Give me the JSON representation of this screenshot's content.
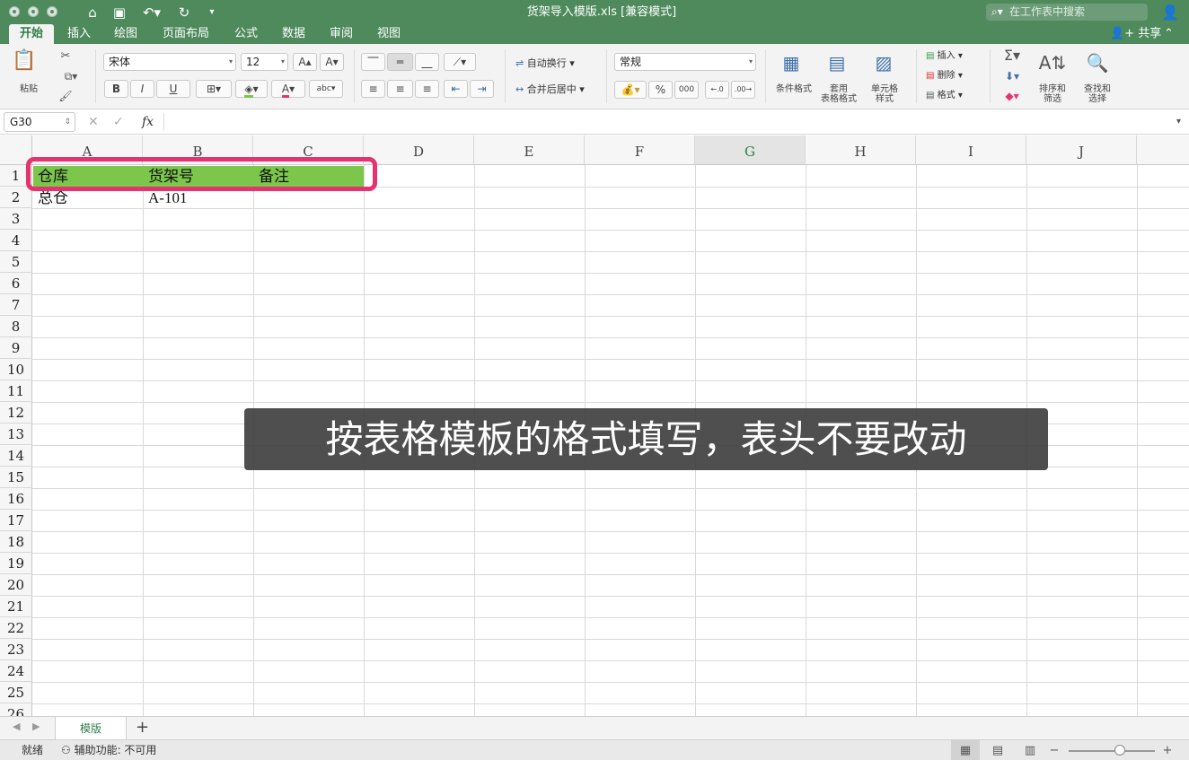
{
  "window": {
    "title": "货架导入模版.xls [兼容模式]",
    "search_placeholder": "在工作表中搜索"
  },
  "ribbon_tabs": [
    "开始",
    "插入",
    "绘图",
    "页面布局",
    "公式",
    "数据",
    "审阅",
    "视图"
  ],
  "active_tab": "开始",
  "share_label": "共享",
  "ribbon": {
    "paste": "粘贴",
    "font_name": "宋体",
    "font_size": "12",
    "bold": "B",
    "italic": "I",
    "underline": "U",
    "wrap_text": "自动换行",
    "merge_center": "合并后居中",
    "number_format": "常规",
    "percent": "%",
    "thousands": "000",
    "conditional_format": "条件格式",
    "table_format": "套用\n表格格式",
    "cell_style": "单元格\n样式",
    "insert": "插入",
    "delete": "删除",
    "format": "格式",
    "sort_filter": "排序和\n筛选",
    "find_select": "查找和\n选择"
  },
  "formula_bar": {
    "name_box": "G30",
    "fx": "fx",
    "formula": ""
  },
  "grid": {
    "columns": [
      "A",
      "B",
      "C",
      "D",
      "E",
      "F",
      "G",
      "H",
      "I",
      "J"
    ],
    "active_column": "G",
    "rows": [
      "1",
      "2",
      "3",
      "4",
      "5",
      "6",
      "7",
      "8",
      "9",
      "10",
      "11",
      "12",
      "13",
      "14",
      "15",
      "16",
      "17",
      "18",
      "19",
      "20",
      "21",
      "22",
      "23",
      "24",
      "25",
      "26"
    ],
    "header_row": [
      "仓库",
      "货架号",
      "备注"
    ],
    "data_row": [
      "总仓",
      "A-101",
      ""
    ]
  },
  "caption": "按表格模板的格式填写，表头不要改动",
  "sheet_tabs": [
    "模版"
  ],
  "status": {
    "ready": "就绪",
    "accessibility": "辅助功能: 不可用"
  },
  "colors": {
    "title_green": "#4e8a5c",
    "header_fill": "#7cc64c",
    "highlight_border": "#e5336f"
  }
}
